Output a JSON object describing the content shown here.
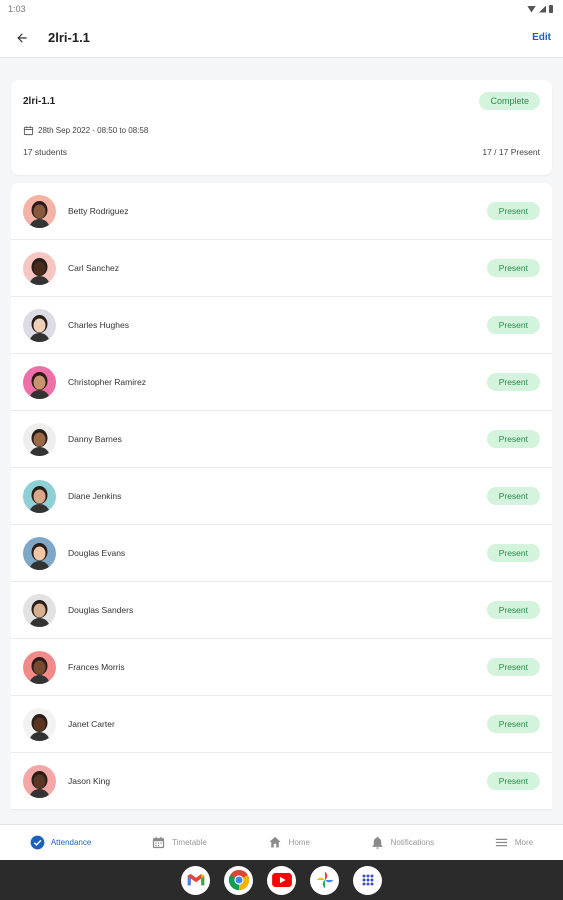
{
  "status_bar": {
    "time": "1:03"
  },
  "app_bar": {
    "title": "2lri-1.1",
    "edit_label": "Edit"
  },
  "summary": {
    "class_name": "2lri-1.1",
    "status": "Complete",
    "date_time": "28th Sep 2022 - 08:50 to 08:58",
    "students_count": "17 students",
    "present_summary": "17 / 17 Present"
  },
  "students": [
    {
      "name": "Betty Rodriguez",
      "status": "Present",
      "avatar_bg": "#f4b3a6",
      "skin": "#8a5a3c"
    },
    {
      "name": "Carl Sanchez",
      "status": "Present",
      "avatar_bg": "#f6c7c0",
      "skin": "#4a2c1c"
    },
    {
      "name": "Charles Hughes",
      "status": "Present",
      "avatar_bg": "#dcdce6",
      "skin": "#f0cfb8"
    },
    {
      "name": "Christopher Ramirez",
      "status": "Present",
      "avatar_bg": "#ef6fa8",
      "skin": "#c9946e"
    },
    {
      "name": "Danny Barnes",
      "status": "Present",
      "avatar_bg": "#eeeeee",
      "skin": "#9a6a48"
    },
    {
      "name": "Diane Jenkins",
      "status": "Present",
      "avatar_bg": "#8fcfd6",
      "skin": "#d9a888"
    },
    {
      "name": "Douglas Evans",
      "status": "Present",
      "avatar_bg": "#7fa7c7",
      "skin": "#f0c6a6"
    },
    {
      "name": "Douglas Sanders",
      "status": "Present",
      "avatar_bg": "#e2e2e2",
      "skin": "#d6b090"
    },
    {
      "name": "Frances Morris",
      "status": "Present",
      "avatar_bg": "#f28a8a",
      "skin": "#7a4a30"
    },
    {
      "name": "Janet Carter",
      "status": "Present",
      "avatar_bg": "#f2f2f2",
      "skin": "#5a3522"
    },
    {
      "name": "Jason King",
      "status": "Present",
      "avatar_bg": "#f5a6a6",
      "skin": "#5b3826"
    }
  ],
  "bottom_nav": [
    {
      "label": "Attendance",
      "icon": "check-circle-icon",
      "active": true
    },
    {
      "label": "Timetable",
      "icon": "calendar-icon",
      "active": false
    },
    {
      "label": "Home",
      "icon": "home-icon",
      "active": false
    },
    {
      "label": "Notifications",
      "icon": "bell-icon",
      "active": false
    },
    {
      "label": "More",
      "icon": "menu-icon",
      "active": false
    }
  ],
  "dock": [
    {
      "icon": "gmail-icon"
    },
    {
      "icon": "chrome-icon"
    },
    {
      "icon": "youtube-icon"
    },
    {
      "icon": "photos-icon"
    },
    {
      "icon": "app-drawer-icon"
    }
  ],
  "colors": {
    "accent": "#1a62b8",
    "badge_bg": "#d4f3dd",
    "badge_text": "#2e8b4a"
  }
}
